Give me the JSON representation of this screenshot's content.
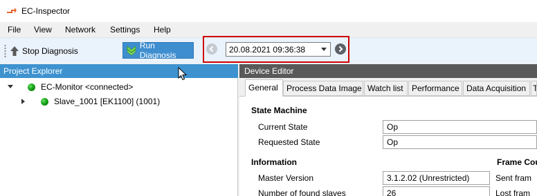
{
  "window": {
    "title": "EC-Inspector",
    "app_icon": "ec-inspector-logo-icon"
  },
  "menu": [
    "File",
    "View",
    "Network",
    "Settings",
    "Help"
  ],
  "toolbar": {
    "stop_label": "Stop Diagnosis",
    "stop_icon": "up-arrow-icon",
    "run_label": "Run Diagnosis",
    "run_icon": "green-down-arrow-icon",
    "run_color": "#3e8ed0",
    "datetime": "20.08.2021 09:36:38",
    "prev_icon": "chevron-left-circle-icon",
    "next_icon": "chevron-right-circle-icon",
    "highlight_color": "#d00000"
  },
  "project_explorer": {
    "title": "Project Explorer",
    "header_color": "#3d92cf",
    "nodes": [
      {
        "label": "EC-Monitor <connected>",
        "status": "green",
        "expanded": true
      },
      {
        "label": "Slave_1001 [EK1100] (1001)",
        "status": "green",
        "expanded": false
      }
    ]
  },
  "device_editor": {
    "title": "Device Editor",
    "tabs": [
      "General",
      "Process Data Image",
      "Watch list",
      "Performance",
      "Data Acquisition",
      "T"
    ],
    "active_tab": "General",
    "state_machine": {
      "title": "State Machine",
      "current_state_label": "Current State",
      "current_state": "Op",
      "requested_state_label": "Requested State",
      "requested_state": "Op"
    },
    "information": {
      "title": "Information",
      "master_version_label": "Master Version",
      "master_version": "3.1.2.02 (Unrestricted)",
      "found_slaves_label": "Number of found slaves",
      "found_slaves": "26"
    },
    "frame_counters": {
      "title": "Frame Cou",
      "sent_label": "Sent fram",
      "lost_label": "Lost fram"
    }
  }
}
